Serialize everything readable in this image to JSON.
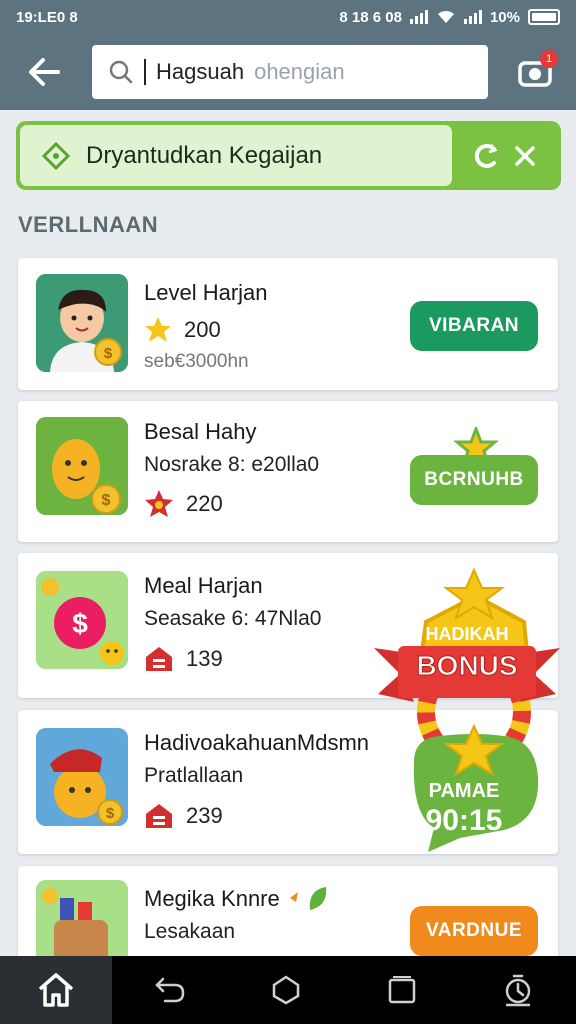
{
  "status": {
    "time": "19:LE0 8",
    "icons_text": "8 18 6 08",
    "battery": "10%"
  },
  "search": {
    "value": "Hagsuah",
    "placeholder": "ohengian"
  },
  "notification_count": "1",
  "banner": {
    "text": "Dryantudkan Kegaijan"
  },
  "section_title": "VERLLNAAN",
  "items": [
    {
      "title": "Level Harjan",
      "points": "200",
      "sub": "seb€3000hn",
      "button": "VIBARAN",
      "button_color": "#1a9a5f",
      "icon": "star-icon"
    },
    {
      "title": "Besal Hahy",
      "sub": "Nosrake 8: e20lla0",
      "points": "220",
      "button": "BCRNUHB",
      "button_color": "#6ab43f",
      "icon": "badge-icon"
    },
    {
      "title": "Meal Harjan",
      "sub": "Seasake 6: 47Nla0",
      "points": "139",
      "icon": "gift-icon"
    },
    {
      "title": "HadivoakahuanMdsmn",
      "sub": "Pratlallaan",
      "points": "239",
      "icon": "gift-icon"
    },
    {
      "title": "Megika Knnre",
      "sub": "Lesakaan",
      "button": "VARDNUE",
      "button_color": "#f08a1c",
      "icon": "leaf-icon"
    }
  ],
  "bonus": {
    "line1": "HADIKAH",
    "line2": "BONUS",
    "line3": "PAMAE",
    "line4": "90:15"
  },
  "colors": {
    "appbar": "#5d7380",
    "accent_green": "#7bc142",
    "bonus_red": "#e53935"
  }
}
